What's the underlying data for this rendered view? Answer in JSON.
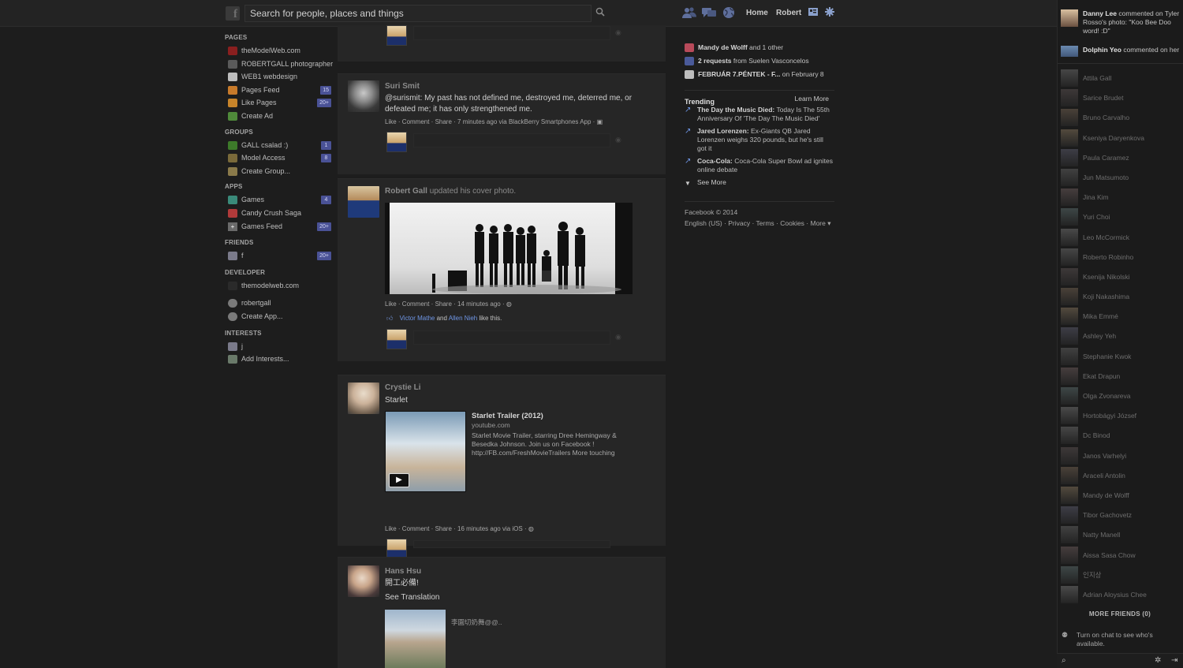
{
  "topbar": {
    "search_placeholder": "Search for people, places and things",
    "home": "Home",
    "profile": "Robert"
  },
  "left_nav": {
    "pages_head": "PAGES",
    "pages": [
      {
        "label": "theModelWeb.com",
        "count": ""
      },
      {
        "label": "ROBERTGALL photographer",
        "count": ""
      },
      {
        "label": "WEB1 webdesign",
        "count": ""
      },
      {
        "label": "Pages Feed",
        "count": "15"
      },
      {
        "label": "Like Pages",
        "count": "20+"
      },
      {
        "label": "Create Ad",
        "count": ""
      }
    ],
    "groups_head": "GROUPS",
    "groups": [
      {
        "label": "GALL csalad :)",
        "count": "1"
      },
      {
        "label": "Model Access",
        "count": "8"
      },
      {
        "label": "Create Group...",
        "count": ""
      }
    ],
    "apps_head": "APPS",
    "apps": [
      {
        "label": "Games",
        "count": "4"
      },
      {
        "label": "Candy Crush Saga",
        "count": ""
      },
      {
        "label": "Games Feed",
        "count": "20+"
      }
    ],
    "friends_head": "FRIENDS",
    "friends": [
      {
        "label": "f",
        "count": "20+"
      }
    ],
    "developer_head": "DEVELOPER",
    "developer": [
      {
        "label": "themodelweb.com"
      },
      {
        "label": "robertgall"
      },
      {
        "label": "Create App..."
      }
    ],
    "interests_head": "INTERESTS",
    "interests": [
      {
        "label": "j"
      },
      {
        "label": "Add Interests..."
      }
    ]
  },
  "feed": {
    "story1": {
      "author": "Suri Smit",
      "text": "@surismit: My past has not defined me, destroyed me, deterred me, or defeated me; it has only strengthened me.",
      "actions": "Like · Comment · Share · 7 minutes ago via BlackBerry Smartphones App ·"
    },
    "story2": {
      "author": "Robert Gall",
      "verb": "updated his cover photo.",
      "actions": "Like · Comment · Share · 14 minutes ago ·",
      "likers_a": "Victor Mathe",
      "likers_and": "and",
      "likers_b": "Allen Nieh",
      "likers_tail": "like this."
    },
    "story3": {
      "author": "Crystie Li",
      "text": "Starlet",
      "link_title": "Starlet Trailer (2012)",
      "link_domain": "youtube.com",
      "link_desc": "Starlet Movie Trailer, starring Dree Hemingway & Besedka Johnson. Join us on Facebook ! http://FB.com/FreshMovieTrailers More touching",
      "actions": "Like · Comment · Share · 16 minutes ago via iOS ·"
    },
    "story4": {
      "author": "Hans Hsu",
      "text": "開工必備!",
      "see_translation": "See Translation",
      "caption": "李園切奶舞@@.."
    }
  },
  "right_col": {
    "reminders": [
      {
        "bold": "Mandy de Wolff",
        "rest": " and 1 other"
      },
      {
        "bold": "2 requests",
        "rest": " from Suelen Vasconcelos"
      },
      {
        "bold": "FEBRUÁR 7.PÉNTEK - F...",
        "rest": " on February 8"
      }
    ],
    "trending_head": "Trending",
    "learn_more": "Learn More",
    "trends": [
      {
        "bold": "The Day the Music Died:",
        "rest": " Today Is The 55th Anniversary Of 'The Day The Music Died'"
      },
      {
        "bold": "Jared Lorenzen:",
        "rest": " Ex-Giants QB Jared Lorenzen weighs 320 pounds, but he's still got it"
      },
      {
        "bold": "Coca-Cola:",
        "rest": " Coca-Cola Super Bowl ad ignites online debate"
      }
    ],
    "see_more": "See More",
    "copyright": "Facebook © 2014",
    "footer_links": "English (US) · Privacy · Terms · Cookies · More ▾"
  },
  "chat": {
    "ticker": [
      {
        "bold": "Danny Lee",
        "rest": " commented on Tyler Rosso's photo: \"Koo Bee Doo word! :D\""
      },
      {
        "bold": "Dolphin Yeo",
        "rest": " commented on her"
      }
    ],
    "friends": [
      "Attila Gall",
      "Sarice Brudet",
      "Bruno Carvalho",
      "Kseniya Daryenkova",
      "Paula Caramez",
      "Jun Matsumoto",
      "Jina Kim",
      "Yuri Choi",
      "Leo McCormick",
      "Roberto Robinho",
      "Ksenija Nikolski",
      "Koji Nakashima",
      "Mika Emmé",
      "Ashley Yeh",
      "Stephanie Kwok",
      "Ekat Drapun",
      "Olga Zvonareva",
      "Hortobágyi József",
      "Dc Binod",
      "Janos Varhelyi",
      "Araceli Antolin",
      "Mandy de Wolff",
      "Tibor Gachovetz",
      "Natty Manell",
      "Aissa Sasa Chow",
      "인지상",
      "Adrian Aloysius Chee"
    ],
    "more_friends": "MORE FRIENDS (0)",
    "chat_off": "Turn on chat to see who's available."
  }
}
